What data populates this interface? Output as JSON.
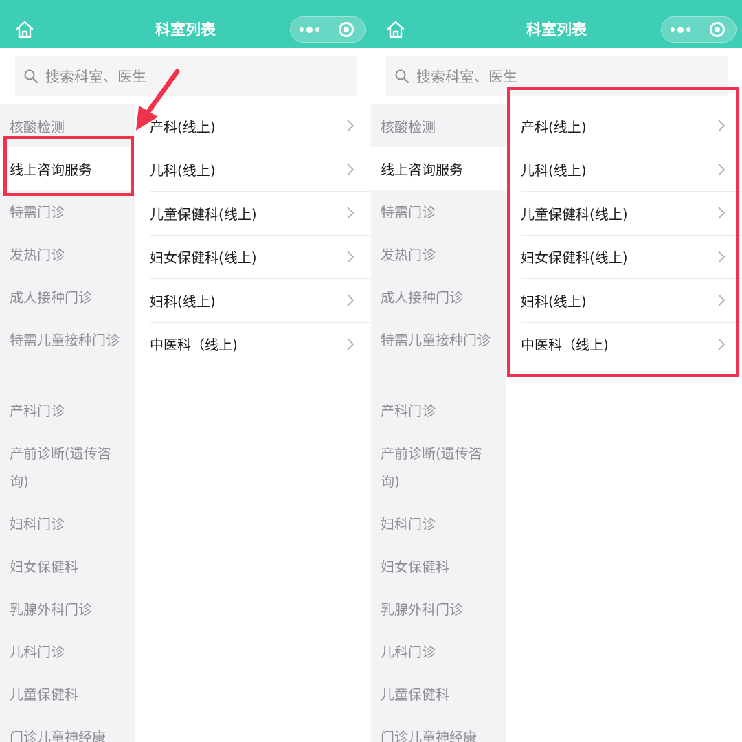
{
  "header": {
    "title": "科室列表"
  },
  "search": {
    "placeholder": "搜索科室、医生"
  },
  "sidebar": {
    "items": [
      {
        "label": "核酸检测"
      },
      {
        "label": "线上咨询服务"
      },
      {
        "label": "特需门诊"
      },
      {
        "label": "发热门诊"
      },
      {
        "label": "成人接种门诊"
      },
      {
        "label": "特需儿童接种门诊"
      },
      {
        "label": "产科门诊"
      },
      {
        "label": "产前诊断(遗传咨询)"
      },
      {
        "label": "妇科门诊"
      },
      {
        "label": "妇女保健科"
      },
      {
        "label": "乳腺外科门诊"
      },
      {
        "label": "儿科门诊"
      },
      {
        "label": "儿童保健科"
      },
      {
        "label": "门诊儿童神经康"
      }
    ],
    "active_index": 1
  },
  "departments": [
    {
      "label": "产科(线上)"
    },
    {
      "label": "儿科(线上)"
    },
    {
      "label": "儿童保健科(线上)"
    },
    {
      "label": "妇女保健科(线上)"
    },
    {
      "label": "妇科(线上)"
    },
    {
      "label": "中医科（线上)"
    }
  ],
  "theme": {
    "header_color": "#3ecdb5",
    "highlight_color": "#f0334d",
    "sidebar_bg": "#f2f3f5"
  },
  "icons": [
    "home-icon",
    "more-dots-icon",
    "close-target-icon",
    "search-icon",
    "chevron-right-icon",
    "arrow-annotation"
  ]
}
